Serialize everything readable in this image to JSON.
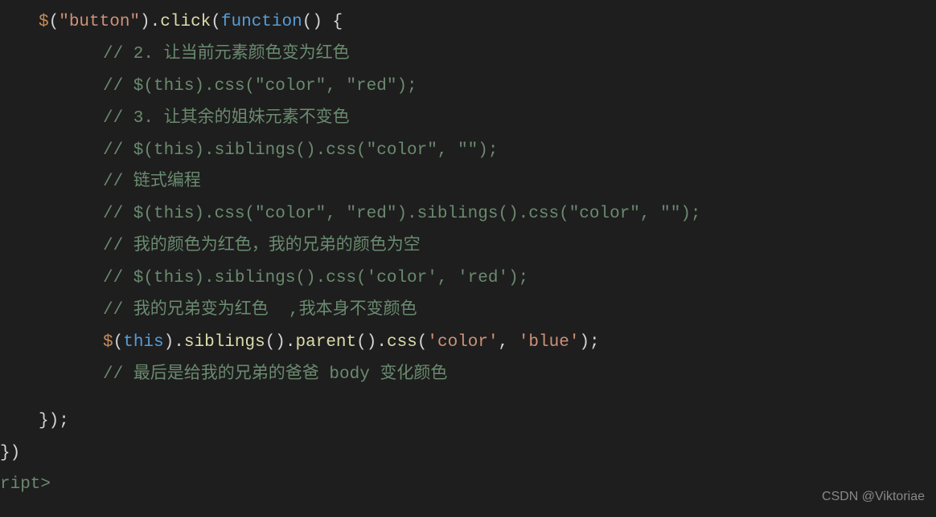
{
  "code": {
    "l1_p1_dollar": "$",
    "l1_p2_paren": "(",
    "l1_p3_str": "\"button\"",
    "l1_p4_paren": ")",
    "l1_p5_dot": ".",
    "l1_p6_click": "click",
    "l1_p7_paren": "(",
    "l1_p8_func": "function",
    "l1_p9_rest": "() {",
    "l2": "// 2. 让当前元素颜色变为红色",
    "l3": "// $(this).css(\"color\", \"red\");",
    "l4": "// 3. 让其余的姐妹元素不变色",
    "l5": "// $(this).siblings().css(\"color\", \"\");",
    "l6": "// 链式编程",
    "l7": "// $(this).css(\"color\", \"red\").siblings().css(\"color\", \"\");",
    "l8": "// 我的颜色为红色，我的兄弟的颜色为空",
    "l9": "// $(this).siblings().css('color', 'red');",
    "l10": "// 我的兄弟变为红色  ,我本身不变颜色",
    "l11_p1_dollar": "$",
    "l11_p2_paren": "(",
    "l11_p3_this": "this",
    "l11_p4_paren": ")",
    "l11_p5_dot": ".",
    "l11_p6_sib": "siblings",
    "l11_p7_paren": "()",
    "l11_p8_dot": ".",
    "l11_p9_parent": "parent",
    "l11_p10_paren": "()",
    "l11_p11_dot": ".",
    "l11_p12_css": "css",
    "l11_p13_paren": "(",
    "l11_p14_str1": "'color'",
    "l11_p15_comma": ", ",
    "l11_p16_str2": "'blue'",
    "l11_p17_end": ");",
    "l12": "// 最后是给我的兄弟的爸爸 body 变化颜色",
    "l13": "});",
    "l14": "})",
    "l15": "ript>"
  },
  "watermark": "CSDN @Viktoriae"
}
